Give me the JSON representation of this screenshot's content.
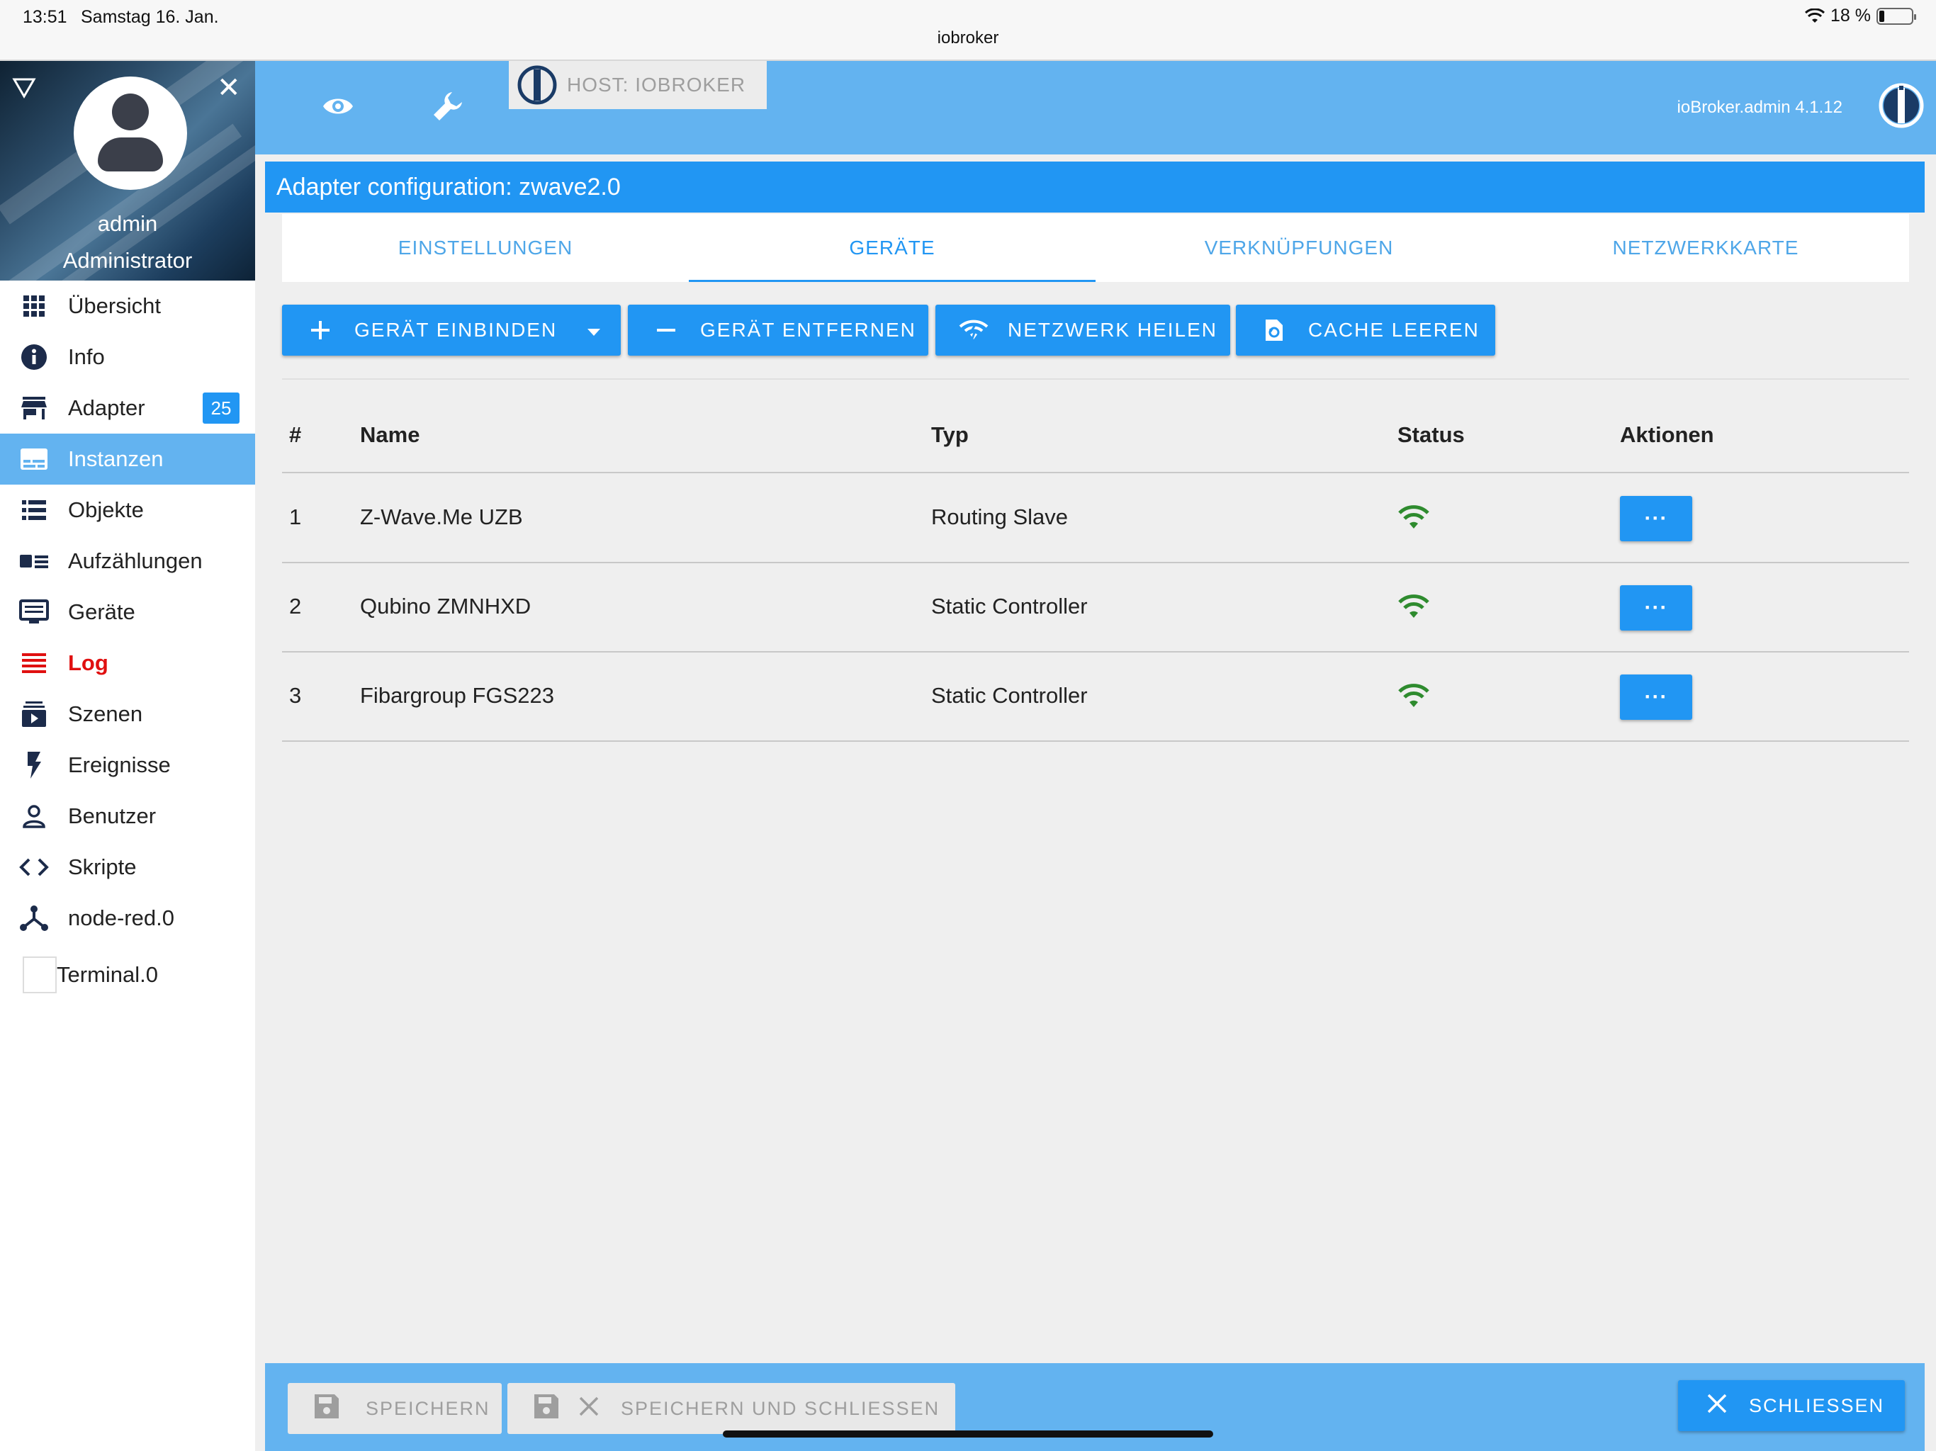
{
  "statusbar": {
    "time": "13:51",
    "date": "Samstag 16. Jan.",
    "url": "iobroker",
    "battery": "18 %"
  },
  "user": {
    "name": "admin",
    "role": "Administrator"
  },
  "sidebar": {
    "items": [
      {
        "label": "Übersicht",
        "icon": "apps-grid-icon"
      },
      {
        "label": "Info",
        "icon": "info-icon"
      },
      {
        "label": "Adapter",
        "icon": "store-icon",
        "badge": "25"
      },
      {
        "label": "Instanzen",
        "icon": "instances-icon",
        "active": true
      },
      {
        "label": "Objekte",
        "icon": "list-icon"
      },
      {
        "label": "Aufzählungen",
        "icon": "enums-icon"
      },
      {
        "label": "Geräte",
        "icon": "devices-icon"
      },
      {
        "label": "Log",
        "icon": "log-icon"
      },
      {
        "label": "Szenen",
        "icon": "scenes-icon"
      },
      {
        "label": "Ereignisse",
        "icon": "flash-icon"
      },
      {
        "label": "Benutzer",
        "icon": "user-icon"
      },
      {
        "label": "Skripte",
        "icon": "code-icon"
      },
      {
        "label": "node-red.0",
        "icon": "node-red-icon"
      },
      {
        "label": "Terminal.0",
        "icon": "terminal-icon"
      }
    ]
  },
  "header": {
    "host": "HOST: IOBROKER",
    "admin_version": "ioBroker.admin 4.1.12"
  },
  "config": {
    "title": "Adapter configuration: zwave2.0"
  },
  "tabs": [
    {
      "label": "EINSTELLUNGEN"
    },
    {
      "label": "GERÄTE",
      "active": true
    },
    {
      "label": "VERKNÜPFUNGEN"
    },
    {
      "label": "NETZWERKKARTE"
    }
  ],
  "actions": {
    "include": "GERÄT EINBINDEN",
    "remove": "GERÄT ENTFERNEN",
    "heal": "NETZWERK HEILEN",
    "clear_cache": "CACHE LEEREN"
  },
  "table": {
    "headers": {
      "num": "#",
      "name": "Name",
      "type": "Typ",
      "status": "Status",
      "actions": "Aktionen"
    },
    "rows": [
      {
        "num": "1",
        "name": "Z-Wave.Me UZB",
        "type": "Routing Slave",
        "status": "wifi-icon",
        "action": "···"
      },
      {
        "num": "2",
        "name": "Qubino ZMNHXD",
        "type": "Static Controller",
        "status": "wifi-icon",
        "action": "···"
      },
      {
        "num": "3",
        "name": "Fibargroup FGS223",
        "type": "Static Controller",
        "status": "wifi-icon",
        "action": "···"
      }
    ]
  },
  "footer": {
    "save": "SPEICHERN",
    "save_close": "SPEICHERN UND SCHLIESSEN",
    "close": "SCHLIESSEN"
  },
  "colors": {
    "primary": "#2196f3",
    "header": "#63b3f0",
    "status_ok": "#2e8b2e",
    "log": "#e01010"
  }
}
